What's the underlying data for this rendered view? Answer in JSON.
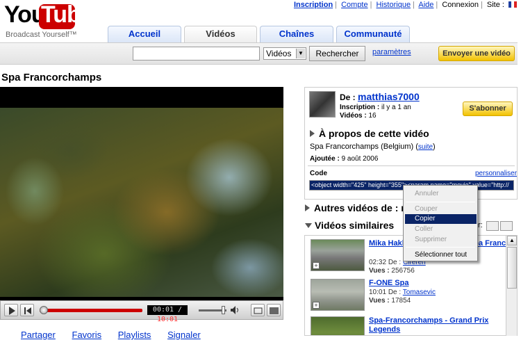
{
  "logo": {
    "you": "You",
    "tube": "Tube",
    "tagline": "Broadcast Yourself™"
  },
  "top_links": [
    "Inscription",
    "Compte",
    "Historique",
    "Aide",
    "Connexion",
    "Site :"
  ],
  "tabs": [
    "Accueil",
    "Vidéos",
    "Chaînes",
    "Communauté"
  ],
  "search": {
    "value": "",
    "category": "Vidéos",
    "button": "Rechercher",
    "params_link": "paramètres"
  },
  "upload_button": "Envoyer une vidéo",
  "video": {
    "title": "Spa Francorchamps"
  },
  "player": {
    "time_current": "00:01",
    "time_total": "10:01",
    "progress": 0.02
  },
  "actions": [
    "Partager",
    "Favoris",
    "Playlists",
    "Signaler"
  ],
  "uploader": {
    "from_label": "De :",
    "name": "matthias7000",
    "joined_label": "Inscription :",
    "joined_value": "il y a 1 an",
    "videos_label": "Vidéos :",
    "videos_value": "16",
    "subscribe": "S'abonner"
  },
  "about": {
    "heading": "À propos de cette vidéo",
    "description": "Spa Francorchamps (Belgium)",
    "more_link": "suite",
    "added_label": "Ajoutée :",
    "added_value": "9 août 2006",
    "code_label": "Code",
    "customize_link": "personnaliser",
    "embed_code": "<object width=\"425\" height=\"355\"><param name=\"movie\" value=\"http://"
  },
  "other_videos_heading": "Autres vidéos de : m",
  "similar_heading": "Vidéos similaires",
  "view_label": "r:",
  "related": [
    {
      "title": "Mika Hakk",
      "title_tail": "macher - Spa Franco",
      "duration": "02:32",
      "from": "De :",
      "author": "Cirérén",
      "views_label": "Vues :",
      "views": "256756"
    },
    {
      "title": "F-ONE Spa",
      "duration": "10:01",
      "from": "De :",
      "author": "Tomasevic",
      "views_label": "Vues :",
      "views": "17854"
    },
    {
      "title": "Spa-Francorchamps - Grand Prix Legends"
    }
  ],
  "context_menu": [
    "Annuler",
    "Couper",
    "Copier",
    "Coller",
    "Supprimer",
    "Sélectionner tout"
  ]
}
